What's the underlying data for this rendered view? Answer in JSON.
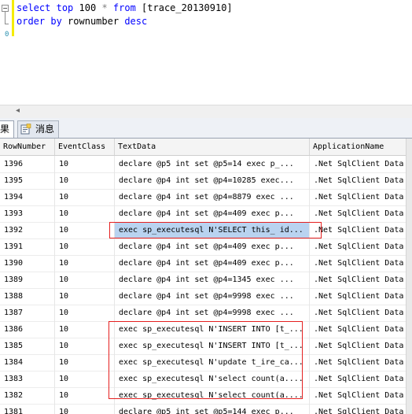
{
  "editor": {
    "line1": {
      "kw1": "select",
      "kw2": "top",
      "num": "100",
      "star": "*",
      "kw3": "from",
      "table": "[trace_20130910]"
    },
    "line2": {
      "kw1": "order",
      "kw2": "by",
      "col": "rownumber",
      "kw3": "desc"
    },
    "fold_glyph": "−",
    "ruler_number": "0"
  },
  "scroll": {
    "left_arrow": "◂"
  },
  "tabs": {
    "results": "果",
    "messages": "消息"
  },
  "grid": {
    "headers": [
      "RowNumber",
      "EventClass",
      "TextData",
      "ApplicationName"
    ],
    "selected_row": 4,
    "rows": [
      [
        "1396",
        "10",
        "declare @p5 int  set @p5=14  exec p_...",
        ".Net SqlClient Data P"
      ],
      [
        "1395",
        "10",
        "declare @p4 int  set @p4=10285  exec...",
        ".Net SqlClient Data P"
      ],
      [
        "1394",
        "10",
        "declare @p4 int  set @p4=8879  exec ...",
        ".Net SqlClient Data P"
      ],
      [
        "1393",
        "10",
        "declare @p4 int  set @p4=409  exec p...",
        ".Net SqlClient Data P"
      ],
      [
        "1392",
        "10",
        "exec sp_executesql N'SELECT this_ id...",
        ".Net SqlClient Data P"
      ],
      [
        "1391",
        "10",
        "declare @p4 int  set @p4=409  exec p...",
        ".Net SqlClient Data P"
      ],
      [
        "1390",
        "10",
        "declare @p4 int  set @p4=409  exec p...",
        ".Net SqlClient Data P"
      ],
      [
        "1389",
        "10",
        "declare @p4 int  set @p4=1345  exec ...",
        ".Net SqlClient Data P"
      ],
      [
        "1388",
        "10",
        "declare @p4 int  set @p4=9998  exec ...",
        ".Net SqlClient Data P"
      ],
      [
        "1387",
        "10",
        "declare @p4 int  set @p4=9998  exec ...",
        ".Net SqlClient Data P"
      ],
      [
        "1386",
        "10",
        "exec sp_executesql N'INSERT INTO [t_...",
        ".Net SqlClient Data P"
      ],
      [
        "1385",
        "10",
        "exec sp_executesql N'INSERT INTO [t_...",
        ".Net SqlClient Data P"
      ],
      [
        "1384",
        "10",
        "exec sp_executesql N'update t_ire_ca...",
        ".Net SqlClient Data P"
      ],
      [
        "1383",
        "10",
        "exec sp_executesql N'select count(a....",
        ".Net SqlClient Data P"
      ],
      [
        "1382",
        "10",
        "exec sp_executesql N'select count(a....",
        ".Net SqlClient Data P"
      ],
      [
        "1381",
        "10",
        "declare @p5 int  set @p5=144  exec p...",
        ".Net SqlClient Data P"
      ]
    ]
  },
  "colors": {
    "keyword": "#0000ff",
    "margin": "#f5ec00",
    "highlight_border": "#e52020",
    "selection": "#b9d3f0"
  }
}
